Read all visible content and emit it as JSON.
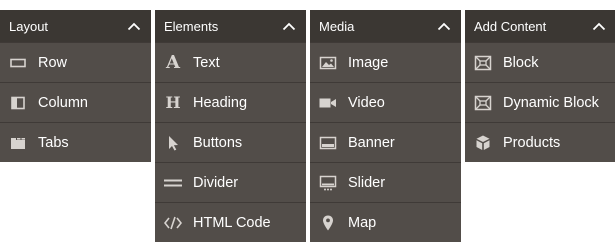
{
  "panels": {
    "layout": {
      "title": "Layout",
      "items": [
        {
          "label": "Row",
          "icon": "row-icon"
        },
        {
          "label": "Column",
          "icon": "column-icon"
        },
        {
          "label": "Tabs",
          "icon": "tabs-icon"
        }
      ]
    },
    "elements": {
      "title": "Elements",
      "items": [
        {
          "label": "Text",
          "icon": "text-icon",
          "glyph": "A"
        },
        {
          "label": "Heading",
          "icon": "heading-icon",
          "glyph": "H"
        },
        {
          "label": "Buttons",
          "icon": "cursor-icon"
        },
        {
          "label": "Divider",
          "icon": "divider-icon"
        },
        {
          "label": "HTML Code",
          "icon": "code-icon"
        }
      ]
    },
    "media": {
      "title": "Media",
      "items": [
        {
          "label": "Image",
          "icon": "image-icon"
        },
        {
          "label": "Video",
          "icon": "video-icon"
        },
        {
          "label": "Banner",
          "icon": "banner-icon"
        },
        {
          "label": "Slider",
          "icon": "slider-icon"
        },
        {
          "label": "Map",
          "icon": "map-pin-icon"
        }
      ]
    },
    "add_content": {
      "title": "Add Content",
      "items": [
        {
          "label": "Block",
          "icon": "block-icon"
        },
        {
          "label": "Dynamic Block",
          "icon": "dynamic-block-icon"
        },
        {
          "label": "Products",
          "icon": "products-icon"
        }
      ]
    }
  },
  "colors": {
    "header_bg": "#3b3733",
    "panel_bg": "#524d49",
    "divider": "#3f3a37",
    "text": "#ffffff",
    "icon": "#d7d3cf"
  }
}
